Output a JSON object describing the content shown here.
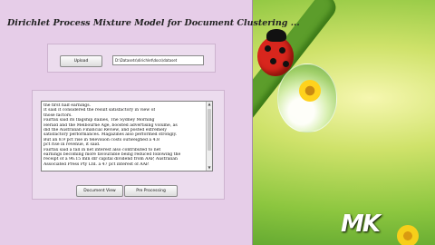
{
  "window": {
    "title": "Dirichlet Process Mixture Model for Document Clustering ..."
  },
  "upload": {
    "button_label": "Upload",
    "path_value": "D:\\Datasets\\dirichlet\\docs\\dataset"
  },
  "document": {
    "lines": [
      "the first half earnings.",
      "   It said it considered the result satisfactory in view of",
      "those factors.",
      "   Fairfax said its flagship dailies, The Sydney Morning",
      "Herald and the Melbourne Age, boosted advertising volume, as",
      "did the Australian Financial Review, and posted extremely",
      "satisfactory performances. Magazines also performed strongly.",
      "   But an 8.9 pct rise in television costs outweighed a 4.8",
      "pct rise in revenue, it said.",
      "   Fairfax said a fall in net interest also contributed to net",
      "earnings becoming more favourable being reduced following the",
      "receipt of a 96.15 mln dlr capital dividend from AAP, Australian",
      "Associated Press Pty Ltd. a 47 pct interest of AAP."
    ]
  },
  "actions": {
    "document_view_label": "Document View",
    "pre_processing_label": "Pre Processing"
  },
  "desktop": {
    "logo_text": "MK"
  }
}
